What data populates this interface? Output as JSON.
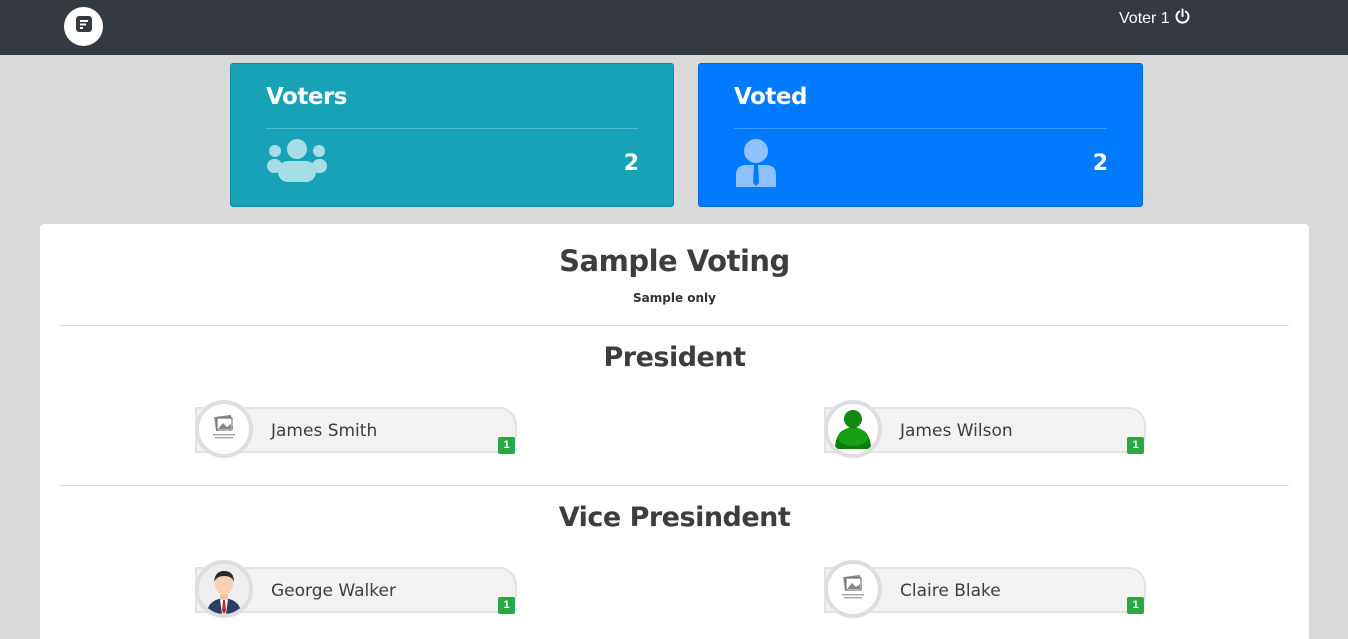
{
  "header": {
    "user_name": "Voter 1",
    "logout_icon": "power-icon",
    "logo_icon": "document-icon"
  },
  "stats": {
    "voters": {
      "title": "Voters",
      "value": "2",
      "icon": "users-icon"
    },
    "voted": {
      "title": "Voted",
      "value": "2",
      "icon": "user-tie-icon"
    }
  },
  "election": {
    "title": "Sample Voting",
    "description": "Sample only"
  },
  "positions": [
    {
      "title": "President",
      "candidates": [
        {
          "name": "James Smith",
          "votes": "1",
          "photo": "image-not-available"
        },
        {
          "name": "James Wilson",
          "votes": "1",
          "photo": "green-figure"
        }
      ]
    },
    {
      "title": "Vice Presindent",
      "candidates": [
        {
          "name": "George Walker",
          "votes": "1",
          "photo": "businessman-avatar"
        },
        {
          "name": "Claire Blake",
          "votes": "1",
          "photo": "image-not-available"
        }
      ]
    }
  ],
  "colors": {
    "topbar": "#343a40",
    "voters_card": "#17a2b8",
    "voted_card": "#007bff",
    "badge": "#28a745"
  }
}
